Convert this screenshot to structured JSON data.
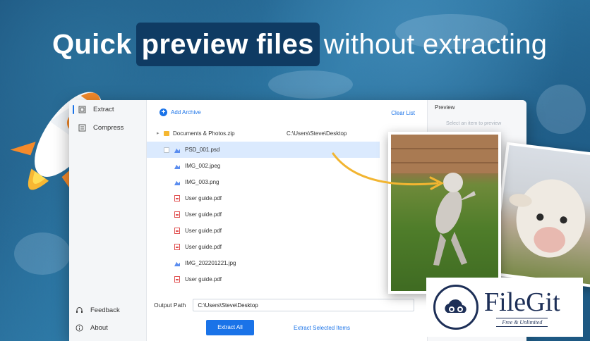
{
  "headline": {
    "word1": "Quick",
    "highlight": "preview files",
    "rest": "without extracting"
  },
  "sidebar": {
    "items": [
      {
        "label": "Extract",
        "icon": "extract-icon",
        "active": true
      },
      {
        "label": "Compress",
        "icon": "compress-icon",
        "active": false
      }
    ],
    "bottom": [
      {
        "label": "Feedback",
        "icon": "headset-icon"
      },
      {
        "label": "About",
        "icon": "info-icon"
      }
    ]
  },
  "toolbar": {
    "add_archive": "Add Archive",
    "clear_list": "Clear List"
  },
  "archive": {
    "name": "Documents & Photos.zip",
    "path": "C:\\Users\\Steve\\Desktop"
  },
  "files": [
    {
      "name": "PSD_001.psd",
      "type": "img",
      "selected": true,
      "checkbox": true
    },
    {
      "name": "IMG_002.jpeg",
      "type": "img",
      "selected": false,
      "checkbox": false
    },
    {
      "name": "IMG_003.png",
      "type": "img",
      "selected": false,
      "checkbox": false
    },
    {
      "name": "User guide.pdf",
      "type": "pdf",
      "selected": false,
      "checkbox": false
    },
    {
      "name": "User guide.pdf",
      "type": "pdf",
      "selected": false,
      "checkbox": false
    },
    {
      "name": "User guide.pdf",
      "type": "pdf",
      "selected": false,
      "checkbox": false
    },
    {
      "name": "User guide.pdf",
      "type": "pdf",
      "selected": false,
      "checkbox": false
    },
    {
      "name": "IMG_202201221.jpg",
      "type": "img",
      "selected": false,
      "checkbox": false
    },
    {
      "name": "User guide.pdf",
      "type": "pdf",
      "selected": false,
      "checkbox": false
    }
  ],
  "output": {
    "label": "Output Path",
    "value": "C:\\Users\\Steve\\Desktop",
    "browse": "···"
  },
  "actions": {
    "extract_all": "Extract All",
    "extract_selected": "Extract Selected Items"
  },
  "preview": {
    "title": "Preview",
    "hint": "Select an item to preview"
  },
  "watermark": {
    "name": "FileGit",
    "tagline": "Free & Unlimited"
  },
  "colors": {
    "accent": "#1a73e8",
    "selected_row": "#dbeafe",
    "headline_box": "#0f3b63"
  }
}
